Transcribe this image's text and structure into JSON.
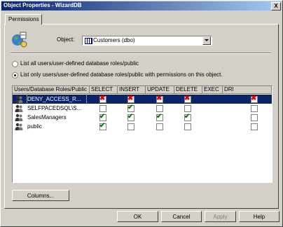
{
  "window": {
    "title": "Object Properties - WizardDB"
  },
  "tabs": [
    {
      "label": "Permissions"
    }
  ],
  "object": {
    "label": "Object:",
    "value": "Customers (dbo)"
  },
  "options": {
    "list_all": "List all users/user-defined database roles/public",
    "list_only": "List only users/user-defined database roles/public with permissions on this object."
  },
  "grid": {
    "columns": [
      "Users/Database Roles/Public",
      "SELECT",
      "INSERT",
      "UPDATE",
      "DELETE",
      "EXEC",
      "DRI"
    ],
    "rows": [
      {
        "name": "DENY_ACCESS_R...",
        "selected": true,
        "perms": [
          "deny",
          "deny",
          "deny",
          "deny",
          "",
          "deny"
        ]
      },
      {
        "name": "SELFPACEDSQL\\S...",
        "selected": false,
        "perms": [
          "none",
          "grant",
          "none",
          "none",
          "",
          "none"
        ]
      },
      {
        "name": "SalesManagers",
        "selected": false,
        "perms": [
          "grant",
          "grant",
          "grant",
          "grant",
          "",
          "none"
        ]
      },
      {
        "name": "public",
        "selected": false,
        "perms": [
          "grant",
          "none",
          "none",
          "none",
          "",
          "none"
        ]
      }
    ]
  },
  "buttons": {
    "columns": "Columns...",
    "ok": "OK",
    "cancel": "Cancel",
    "apply": "Apply",
    "help": "Help",
    "close": "X"
  },
  "colors": {
    "titlebar_start": "#0a246a",
    "titlebar_end": "#a6caf0",
    "grant": "#008000",
    "deny": "#e00000"
  }
}
